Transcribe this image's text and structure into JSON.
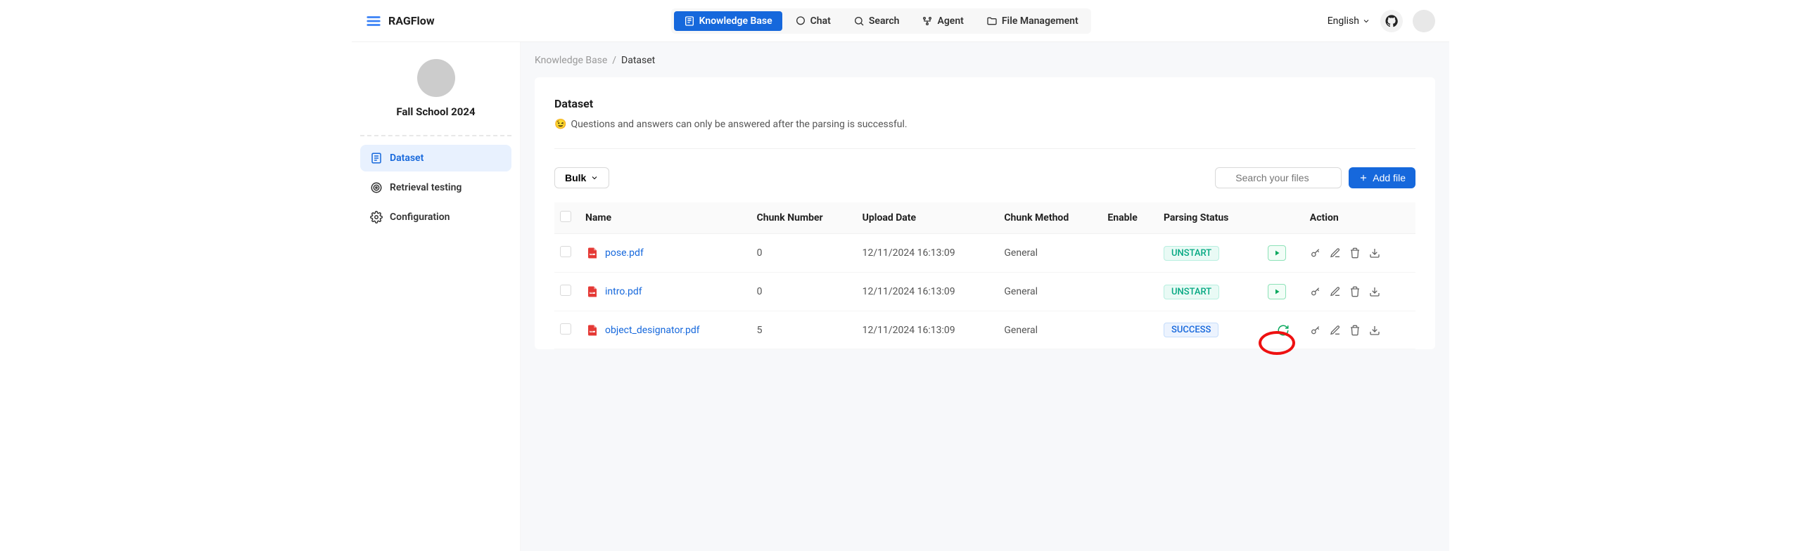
{
  "brand": "RAGFlow",
  "nav": {
    "knowledge_base": "Knowledge Base",
    "chat": "Chat",
    "search": "Search",
    "agent": "Agent",
    "file_mgmt": "File Management"
  },
  "header": {
    "language": "English"
  },
  "sidebar": {
    "kb_name": "Fall School 2024",
    "items": {
      "dataset": "Dataset",
      "retrieval": "Retrieval testing",
      "config": "Configuration"
    }
  },
  "breadcrumb": {
    "root": "Knowledge Base",
    "current": "Dataset"
  },
  "page": {
    "title": "Dataset",
    "note": "Questions and answers can only be answered after the parsing is successful."
  },
  "toolbar": {
    "bulk": "Bulk",
    "search_placeholder": "Search your files",
    "add_file": "Add file"
  },
  "table": {
    "headers": {
      "name": "Name",
      "chunk_number": "Chunk Number",
      "upload_date": "Upload Date",
      "chunk_method": "Chunk Method",
      "enable": "Enable",
      "parsing_status": "Parsing Status",
      "action": "Action"
    },
    "rows": [
      {
        "name": "pose.pdf",
        "chunks": "0",
        "date": "12/11/2024 16:13:09",
        "method": "General",
        "status": "UNSTART",
        "status_kind": "unstart"
      },
      {
        "name": "intro.pdf",
        "chunks": "0",
        "date": "12/11/2024 16:13:09",
        "method": "General",
        "status": "UNSTART",
        "status_kind": "unstart"
      },
      {
        "name": "object_designator.pdf",
        "chunks": "5",
        "date": "12/11/2024 16:13:09",
        "method": "General",
        "status": "SUCCESS",
        "status_kind": "success"
      }
    ]
  }
}
